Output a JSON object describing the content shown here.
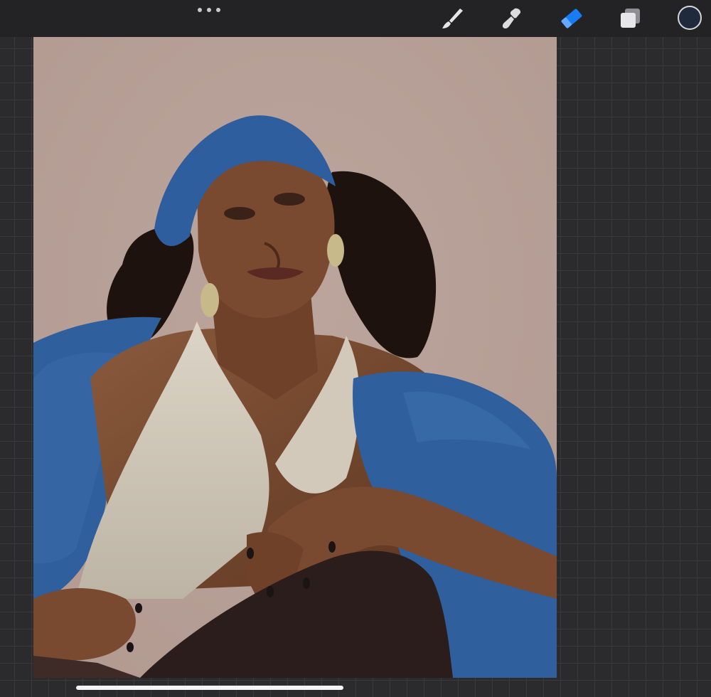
{
  "app": {
    "toolbar": {
      "more_icon": "more-dots-icon",
      "tools": [
        {
          "name": "brush",
          "icon": "brush-icon",
          "active": false
        },
        {
          "name": "smudge",
          "icon": "smudge-icon",
          "active": false
        },
        {
          "name": "eraser",
          "icon": "eraser-icon",
          "active": true
        },
        {
          "name": "layers",
          "icon": "layers-icon",
          "active": false
        }
      ],
      "active_color": "#1f2a3d",
      "accent_color": "#1a7cf5"
    }
  },
  "canvas": {
    "background_color": "#b29a91",
    "artwork": "painting-of-woman-with-blue-headscarf"
  }
}
